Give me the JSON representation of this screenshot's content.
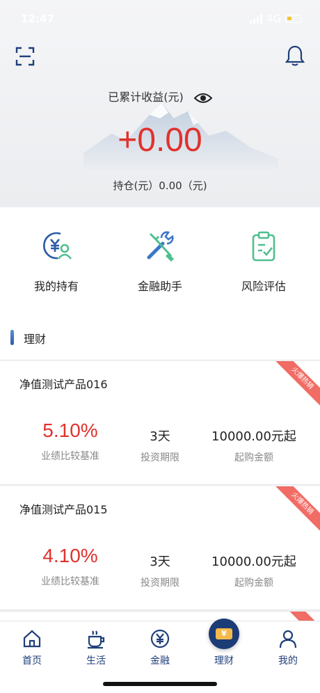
{
  "status": {
    "time": "12:47",
    "network": "4G"
  },
  "summary": {
    "label": "已累计收益(元)",
    "amount": "+0.00",
    "holding": "持仓(元）0.00（元)"
  },
  "actions": [
    {
      "label": "我的持有",
      "icon": "yuan-person-icon"
    },
    {
      "label": "金融助手",
      "icon": "tools-icon"
    },
    {
      "label": "风险评估",
      "icon": "clipboard-check-icon"
    }
  ],
  "section": {
    "title": "理财"
  },
  "products": [
    {
      "name": "净值测试产品016",
      "badge": "火爆热销",
      "rate": "5.10%",
      "rate_label": "业绩比较基准",
      "term": "3天",
      "term_label": "投资期限",
      "min": "10000.00元起",
      "min_label": "起购金额"
    },
    {
      "name": "净值测试产品015",
      "badge": "火爆热销",
      "rate": "4.10%",
      "rate_label": "业绩比较基准",
      "term": "3天",
      "term_label": "投资期限",
      "min": "10000.00元起",
      "min_label": "起购金额"
    }
  ],
  "tabs": [
    {
      "label": "首页",
      "icon": "home-icon"
    },
    {
      "label": "生活",
      "icon": "coffee-cup-icon"
    },
    {
      "label": "金融",
      "icon": "yuan-coin-icon"
    },
    {
      "label": "理财",
      "icon": "ticket-icon",
      "active": true
    },
    {
      "label": "我的",
      "icon": "person-icon"
    }
  ],
  "colors": {
    "accent": "#e0322d",
    "brand": "#1c3c76",
    "icon_blue": "#3a78c9",
    "icon_green": "#4fbf8e"
  }
}
